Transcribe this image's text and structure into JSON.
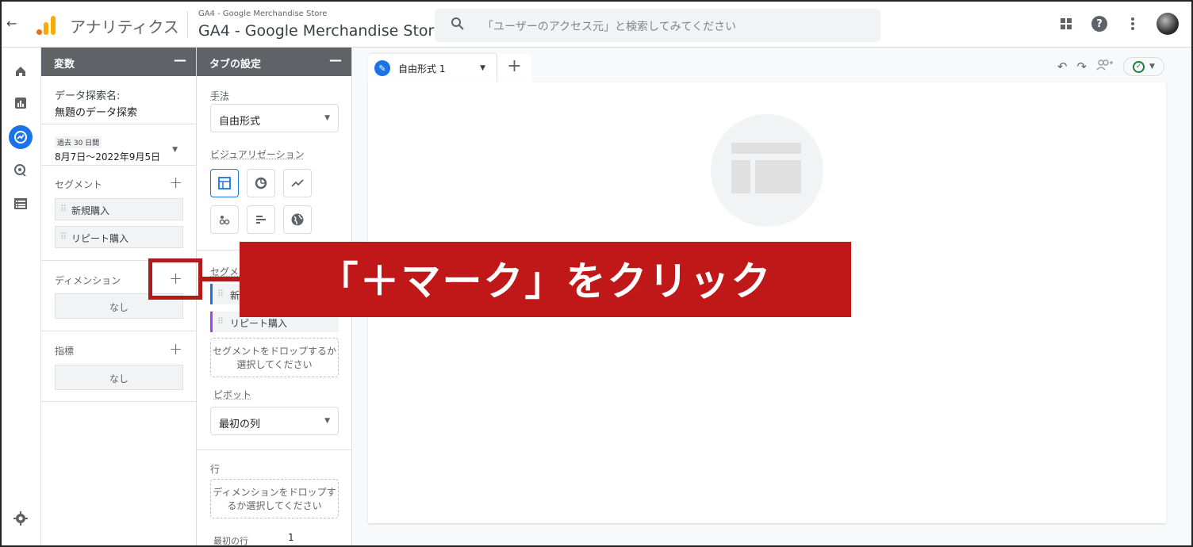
{
  "topbar": {
    "back": "←",
    "app_name": "アナリティクス",
    "property_small": "GA4 - Google Merchandise Store",
    "property_big": "GA4 - Google Merchandise Store",
    "search_placeholder": "「ユーザーのアクセス元」と検索してみてください"
  },
  "variables": {
    "header": "変数",
    "minimize": "—",
    "exploration_name_label": "データ探索名:",
    "exploration_name": "無題のデータ探索",
    "date_badge": "過去 30 日間",
    "date_range": "8月7日～2022年9月5日",
    "segments_label": "セグメント",
    "segments": [
      "新規購入",
      "リピート購入"
    ],
    "dimensions_label": "ディメンション",
    "dimensions_empty": "なし",
    "metrics_label": "指標",
    "metrics_empty": "なし",
    "plus": "+"
  },
  "tab_settings": {
    "header": "タブの設定",
    "minimize": "—",
    "technique_label": "手法",
    "technique_value": "自由形式",
    "visualization_label": "ビジュアリゼーション",
    "segment_compare_label": "セグメントの比較",
    "segments": [
      "新規購入",
      "リピート購入"
    ],
    "segment_drop": "セグメントをドロップするか選択してください",
    "pivot_label": "ピボット",
    "pivot_value": "最初の列",
    "rows_label": "行",
    "rows_drop": "ディメンションをドロップするか選択してください",
    "first_row_label": "最初の行",
    "first_row_value": "1"
  },
  "canvas": {
    "tab_name": "自由形式 1",
    "add_tab": "+"
  },
  "annotation": {
    "callout_text": "「＋マーク」をクリック"
  },
  "colors": {
    "accent": "#1a73e8",
    "annotation_red": "#c01818",
    "header_gray": "#5f6368"
  }
}
